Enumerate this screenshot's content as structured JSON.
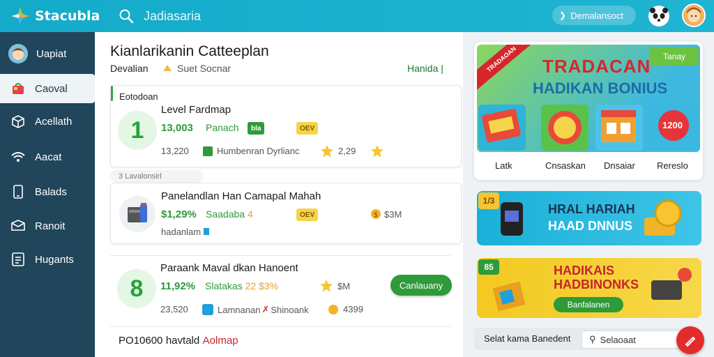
{
  "topbar": {
    "logo_text": "Stacubla",
    "search_text": "Jadiasaria",
    "pill_text": "Demalansoct"
  },
  "sidebar": {
    "items": [
      {
        "label": "Uapiat",
        "icon": "avatar-icon"
      },
      {
        "label": "Caoval",
        "icon": "bag-icon",
        "active": true
      },
      {
        "label": "Acellath",
        "icon": "box-icon"
      },
      {
        "label": "Aacat",
        "icon": "wifi-icon"
      },
      {
        "label": "Balads",
        "icon": "phone-icon"
      },
      {
        "label": "Ranoit",
        "icon": "mail-icon"
      },
      {
        "label": "Hugants",
        "icon": "list-icon"
      }
    ]
  },
  "main": {
    "title": "Kianlarikanin Catteeplan",
    "sub_left": "Devalian",
    "sub_sort": "Suet Socnar",
    "sub_right": "Hanida",
    "card1": {
      "head": "Eotodoan",
      "num": "1",
      "title": "Level Fardmap",
      "price": "13,003",
      "tag": "Panach",
      "tag_badge": "bla",
      "badge": "OEV",
      "small": "13,220",
      "meta": "Humbenran Dyrlianc",
      "meta_num": "2,29"
    },
    "sep": "3 Lavalonsirl",
    "card2": {
      "title": "Panelandlan Han Camapal Mahah",
      "price": "$1,29%",
      "tag": "Saadaba",
      "tag_num": "4",
      "badge": "OEV",
      "coin_val": "$3M",
      "small": "hadanlam"
    },
    "card3": {
      "num": "8",
      "title": "Paraank Maval dkan Hanoent",
      "price": "11,92%",
      "tag": "Slatakas",
      "tag_num": "22",
      "tag_num2": "$3%",
      "coin_val": "$M",
      "small": "23,520",
      "meta": "Lamnanan",
      "meta2": "Shinoank",
      "meta_num": "4399",
      "button": "Canlauany"
    },
    "card4": {
      "title_a": "PO10600",
      "title_b": "havtald",
      "title_c": "Aolmap"
    }
  },
  "right": {
    "promo": {
      "corner": "TRADAOAN",
      "title1": "TRADACAN",
      "title2": "HADIKAN BONIUS",
      "tab": "Tanay",
      "tiles": [
        {
          "label": "Latk"
        },
        {
          "label": "Cnsaskan"
        },
        {
          "label": "Dnsaiar"
        },
        {
          "label": "Rereslo"
        }
      ],
      "tile4_val": "1200"
    },
    "banner2": {
      "badge": "1/3",
      "title1": "HRAL HARIAH",
      "title2": "HAAD DNNUS"
    },
    "banner3": {
      "badge": "85",
      "title1": "HADIKAIS",
      "title2": "HADBINONKS",
      "button": "Banfalanen"
    },
    "bottom": {
      "label": "Selat kama Banedent",
      "input": "Selaoaat"
    }
  },
  "colors": {
    "topbar": "#1eb4d2",
    "sidebar": "#21455a",
    "accent_green": "#2e9a3a",
    "badge_yellow": "#f6d44a",
    "fab_red": "#e32b2b"
  }
}
